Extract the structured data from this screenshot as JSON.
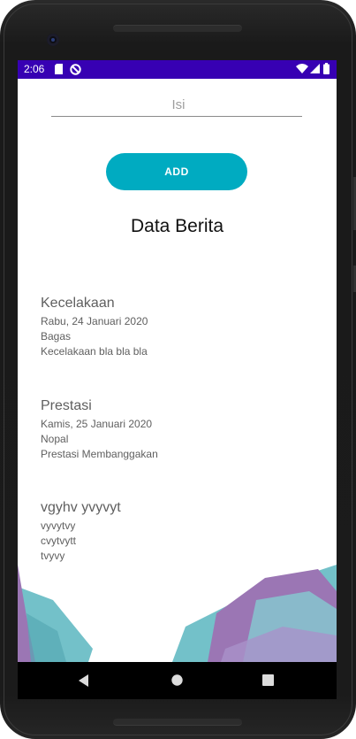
{
  "status_bar": {
    "time": "2:06",
    "icons": [
      "sd-card-icon",
      "do-not-disturb-icon",
      "wifi-icon",
      "signal-icon",
      "battery-icon"
    ]
  },
  "form": {
    "isi_placeholder": "Isi",
    "add_label": "ADD"
  },
  "section_title": "Data Berita",
  "news": [
    {
      "title": "Kecelakaan",
      "date": "Rabu, 24 Januari 2020",
      "author": "Bagas",
      "content": "Kecelakaan bla bla bla"
    },
    {
      "title": "Prestasi",
      "date": "Kamis, 25 Januari 2020",
      "author": "Nopal",
      "content": "Prestasi Membanggakan"
    },
    {
      "title": "vgyhv yvyvyt",
      "date": "vyvytvy",
      "author": "cvytvytt",
      "content": "tvyvy"
    }
  ],
  "colors": {
    "status_bar": "#3700b3",
    "accent": "#00abc1",
    "decor_teal": "#5bb7c0",
    "decor_purple": "#8a5fa8"
  },
  "nav_icons": [
    "back-icon",
    "home-icon",
    "recent-apps-icon"
  ]
}
